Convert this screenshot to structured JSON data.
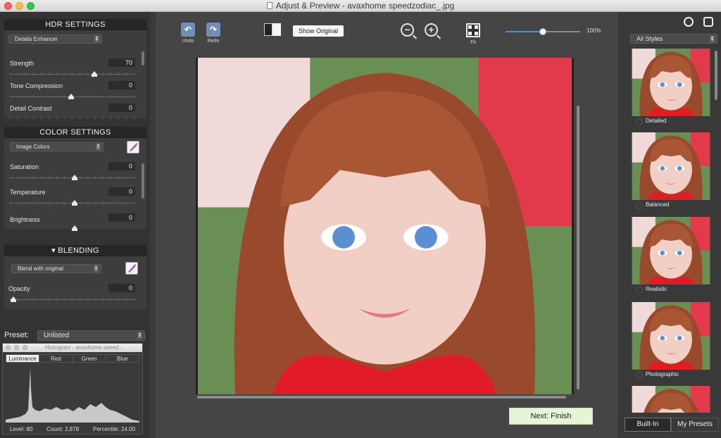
{
  "window": {
    "title": "Adjust & Preview - avaxhome speedzodiac_.jpg"
  },
  "hdr": {
    "header": "HDR SETTINGS",
    "preset": "Details Enhancer",
    "sliders": [
      {
        "label": "Strength",
        "value": "70"
      },
      {
        "label": "Tone Compression",
        "value": "0"
      },
      {
        "label": "Detail Contrast",
        "value": "0"
      }
    ]
  },
  "color": {
    "header": "COLOR SETTINGS",
    "preset": "Image Colors",
    "sliders": [
      {
        "label": "Saturation",
        "value": "0"
      },
      {
        "label": "Temperature",
        "value": "0"
      },
      {
        "label": "Brightness",
        "value": "0"
      }
    ]
  },
  "blending": {
    "header": "BLENDING",
    "mode": "Blend with original",
    "opacity_label": "Opacity",
    "opacity_value": "0"
  },
  "preset": {
    "label": "Preset:",
    "value": "Unlisted"
  },
  "histogram": {
    "title": "Histogram - avaxhome speed...",
    "tabs": [
      "Luminance",
      "Red",
      "Green",
      "Blue"
    ],
    "active_tab": "Luminance",
    "level": "Level: 80",
    "count": "Count: 2,878",
    "percentile": "Percentile: 24.00"
  },
  "toolbar": {
    "undo": "Undo",
    "redo": "Redo",
    "show_original": "Show Original",
    "fit": "Fit",
    "zoom": "100%"
  },
  "next_button": "Next: Finish",
  "styles": {
    "filter": "All Styles",
    "items": [
      "Detailed",
      "Balanced",
      "Realistic",
      "Photographic"
    ],
    "tabs": [
      "Built-In",
      "My Presets"
    ],
    "active_tab": "Built-In"
  },
  "colors": {
    "accent": "#4b8ee8",
    "next_button": "#e6f5d6"
  }
}
